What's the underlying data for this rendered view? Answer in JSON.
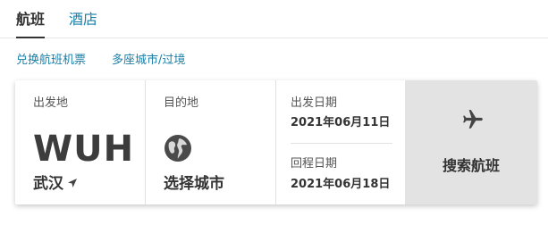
{
  "tabs": [
    {
      "label": "航班",
      "active": true
    },
    {
      "label": "酒店",
      "active": false
    }
  ],
  "links": {
    "exchange": "兑换航班机票",
    "multi_city": "多座城市/过境"
  },
  "origin": {
    "label": "出发地",
    "code": "WUH",
    "city": "武汉",
    "icon": "location-arrow-icon"
  },
  "destination": {
    "label": "目的地",
    "city": "选择城市",
    "icon": "globe-icon"
  },
  "dates": {
    "departure_label": "出发日期",
    "departure_value": "2021年06月11日",
    "return_label": "回程日期",
    "return_value": "2021年06月18日"
  },
  "search": {
    "label": "搜索航班",
    "icon": "airplane-icon"
  },
  "colors": {
    "link": "#1a7fa6",
    "search_bg": "#e3e3e3",
    "text": "#333333"
  }
}
